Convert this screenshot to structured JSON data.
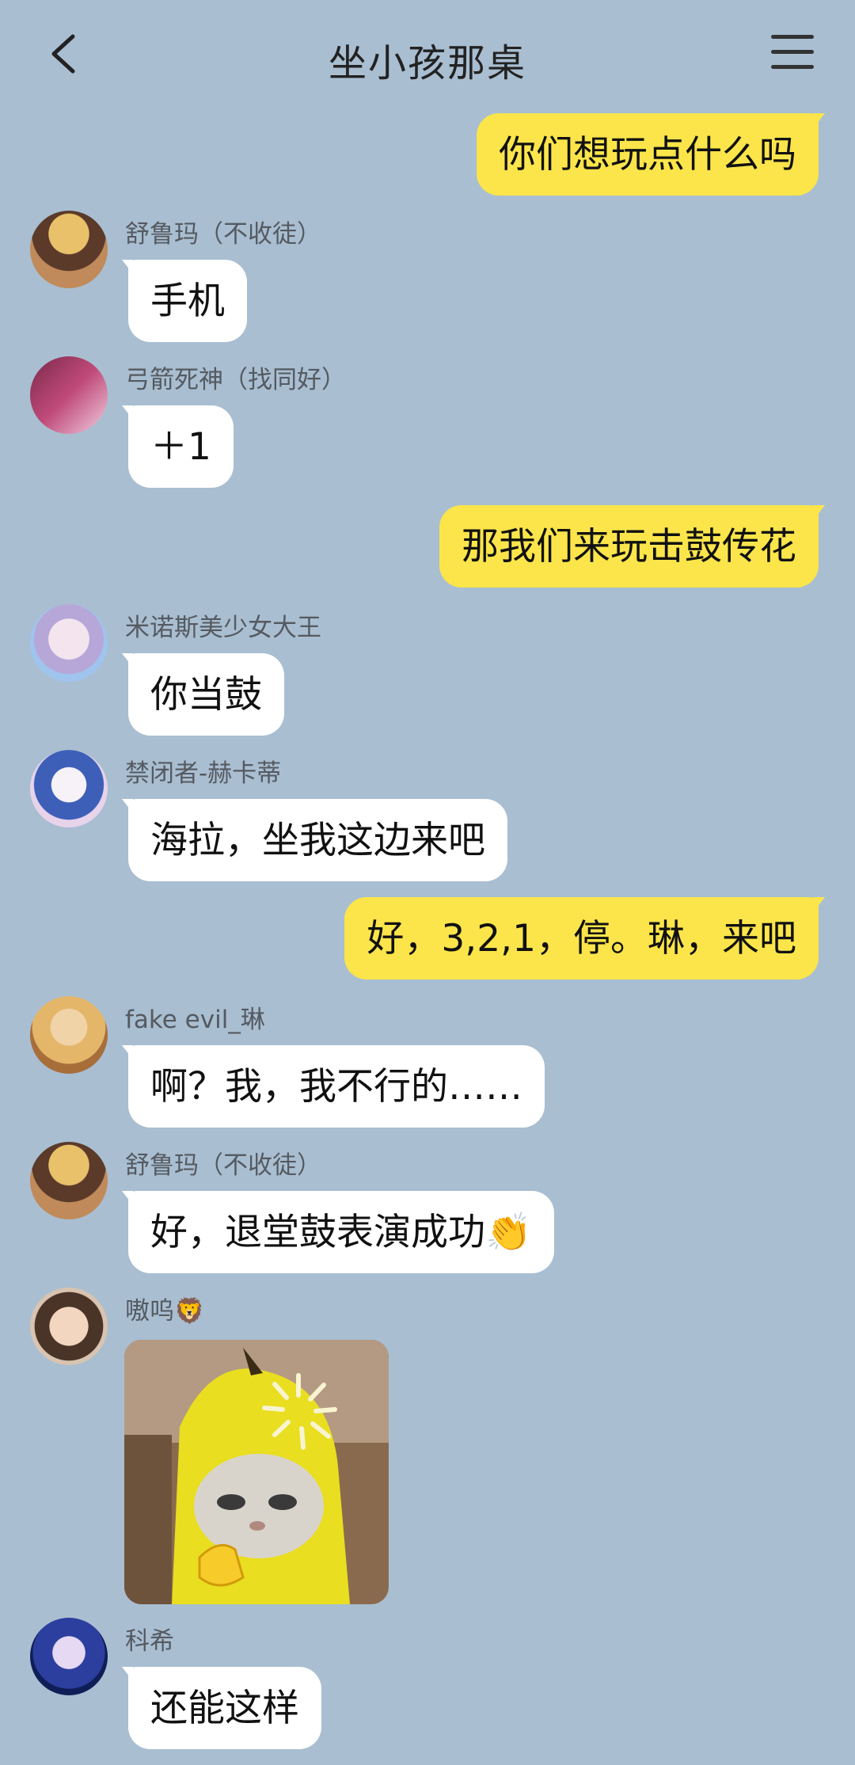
{
  "header": {
    "title": "坐小孩那桌"
  },
  "messages": [
    {
      "side": "right",
      "text": "你们想玩点什么吗"
    },
    {
      "side": "left",
      "name": "舒鲁玛（不收徒）",
      "text": "手机"
    },
    {
      "side": "left",
      "name": "弓箭死神（找同好）",
      "text": "＋1"
    },
    {
      "side": "right",
      "text": "那我们来玩击鼓传花"
    },
    {
      "side": "left",
      "name": "米诺斯美少女大王",
      "text": "你当鼓"
    },
    {
      "side": "left",
      "name": "禁闭者-赫卡蒂",
      "text": "海拉，坐我这边来吧"
    },
    {
      "side": "right",
      "text": "好，3,2,1，停。琳，来吧"
    },
    {
      "side": "left",
      "name": "fake evil_琳",
      "text": "啊？我，我不行的……"
    },
    {
      "side": "left",
      "name": "舒鲁玛（不收徒）",
      "text": "好，退堂鼓表演成功👏"
    },
    {
      "side": "left",
      "name": "嗷呜🦁",
      "sticker": "banana-cat-sticker"
    },
    {
      "side": "left",
      "name": "科希",
      "text": "还能这样"
    }
  ],
  "colors": {
    "background": "#a9bed1",
    "own_bubble": "#fbe54a",
    "other_bubble": "#ffffff"
  }
}
